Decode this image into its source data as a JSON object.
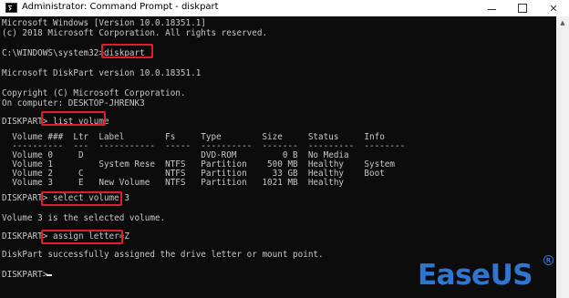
{
  "window": {
    "title": "Administrator: Command Prompt - diskpart",
    "icon": "cmd-icon",
    "controls": {
      "minimize": "minimize-icon",
      "maximize": "maximize-icon",
      "close": "✕"
    }
  },
  "console": {
    "lines": [
      "Microsoft Windows [Version 10.0.18351.1]",
      "(c) 2018 Microsoft Corporation. All rights reserved.",
      "",
      "C:\\WINDOWS\\system32>diskpart",
      "",
      "Microsoft DiskPart version 10.0.18351.1",
      "",
      "Copyright (C) Microsoft Corporation.",
      "On computer: DESKTOP-JHRENK3",
      "",
      "DISKPART> list volume",
      "",
      "  Volume ###  Ltr  Label        Fs     Type        Size     Status     Info",
      "  ----------  ---  -----------  -----  ----------  -------  ---------  --------",
      "  Volume 0     D                       DVD-ROM         0 B  No Media",
      "  Volume 1         System Rese  NTFS   Partition    500 MB  Healthy    System",
      "  Volume 2     C                NTFS   Partition     33 GB  Healthy    Boot",
      "  Volume 3     E   New Volume   NTFS   Partition   1021 MB  Healthy",
      "",
      "DISKPART> select volume 3",
      "",
      "Volume 3 is the selected volume.",
      "",
      "DISKPART> assign letter=Z",
      "",
      "DiskPart successfully assigned the drive letter or mount point.",
      "",
      "DISKPART> "
    ],
    "highlighted_commands": [
      "diskpart",
      "list volume",
      "select volume 3",
      "assign letter=Z"
    ],
    "highlight_color": "#e21c2a",
    "text_color": "#c8c8c8",
    "background_color": "#0c0c0c"
  },
  "watermark": {
    "brand": "EaseUS",
    "registered_mark": "R",
    "color": "#2f76d2"
  }
}
